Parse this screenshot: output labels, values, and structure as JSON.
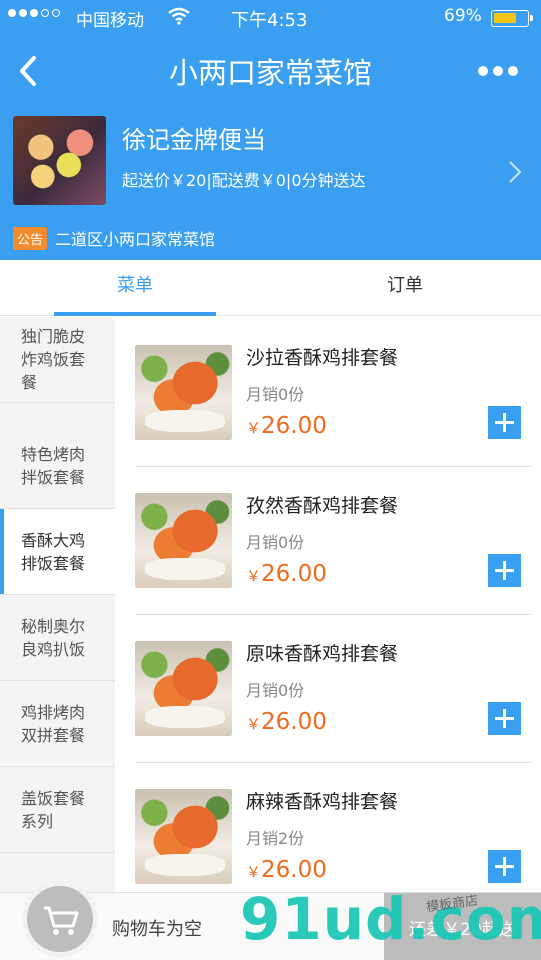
{
  "status_bar": {
    "carrier": "中国移动",
    "time": "下午4:53",
    "battery": "69%",
    "battery_color": "#f5c518"
  },
  "nav": {
    "title": "小两口家常菜馆",
    "back_icon": "chevron-left-icon",
    "more_icon": "more-dots-icon"
  },
  "shop": {
    "name": "徐记金牌便当",
    "info": "起送价￥20|配送费￥0|0分钟送达",
    "notice_tag": "公告",
    "notice_text": "二道区小两口家常菜馆"
  },
  "tabs": [
    {
      "label": "菜单",
      "active": true
    },
    {
      "label": "订单",
      "active": false
    }
  ],
  "categories": [
    {
      "label": "独门脆皮炸鸡饭套餐",
      "active": false
    },
    {
      "label": "特色烤肉拌饭套餐",
      "active": false
    },
    {
      "label": "香酥大鸡排饭套餐",
      "active": true
    },
    {
      "label": "秘制奥尔良鸡扒饭",
      "active": false
    },
    {
      "label": "鸡排烤肉双拼套餐",
      "active": false
    },
    {
      "label": "盖饭套餐系列",
      "active": false
    }
  ],
  "products": [
    {
      "name": "沙拉香酥鸡排套餐",
      "sales": "月销0份",
      "currency": "￥",
      "price": "26.00"
    },
    {
      "name": "孜然香酥鸡排套餐",
      "sales": "月销0份",
      "currency": "￥",
      "price": "26.00"
    },
    {
      "name": "原味香酥鸡排套餐",
      "sales": "月销0份",
      "currency": "￥",
      "price": "26.00"
    },
    {
      "name": "麻辣香酥鸡排套餐",
      "sales": "月销2份",
      "currency": "￥",
      "price": "26.00"
    }
  ],
  "cart": {
    "empty_text": "购物车为空",
    "min_order_text": "还差￥20起送",
    "cart_icon": "shopping-cart-icon"
  },
  "watermark": {
    "text": "91ud.com",
    "sub": "模板商店"
  },
  "colors": {
    "primary": "#3a9ff0",
    "price": "#f26a1b",
    "notice_tag": "#f28c2e"
  }
}
